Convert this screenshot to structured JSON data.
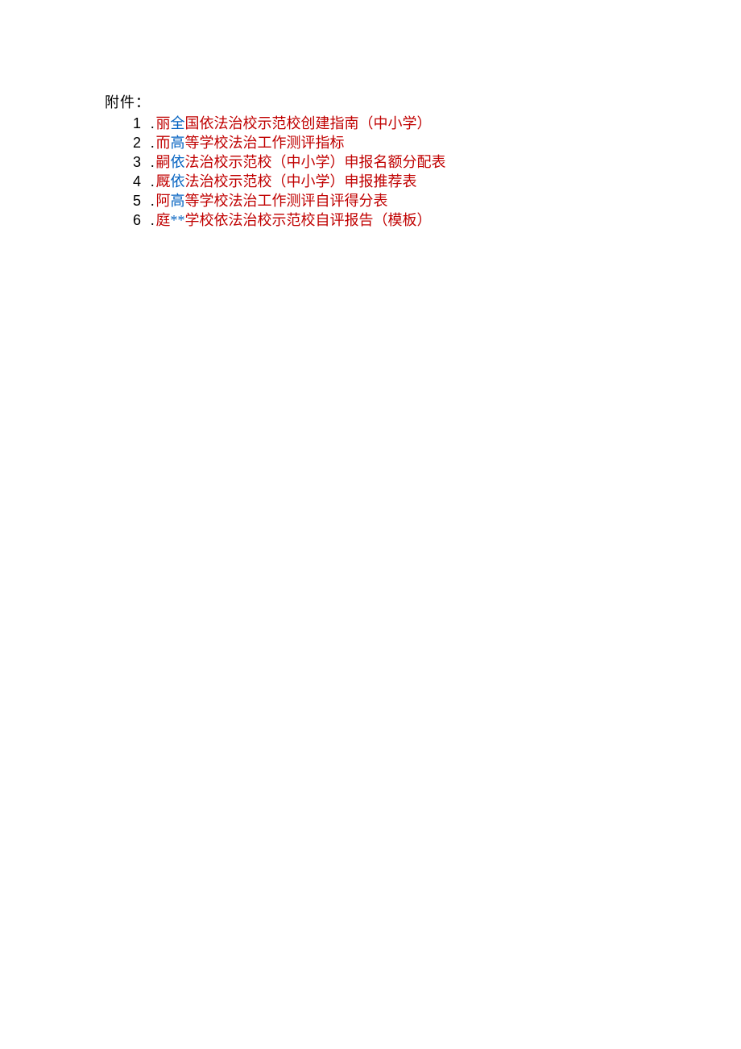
{
  "header": "附件：",
  "items": [
    {
      "num": "1",
      "prefix": "丽",
      "link": "全",
      "rest": "国依法治校示范校创建指南（中小学）"
    },
    {
      "num": "2",
      "prefix": "而",
      "link": "高",
      "rest": "等学校法治工作测评指标"
    },
    {
      "num": "3",
      "prefix": "嗣",
      "link": "依",
      "rest": "法治校示范校（中小学）申报名额分配表"
    },
    {
      "num": "4",
      "prefix": "厩",
      "link": "依",
      "rest": "法治校示范校（中小学）申报推荐表"
    },
    {
      "num": "5",
      "prefix": "阿",
      "link": "高",
      "rest": "等学校法治工作测评自评得分表"
    },
    {
      "num": "6",
      "prefix": "庭",
      "link": "**",
      "rest": "学校依法治校示范校自评报告（模板）"
    }
  ]
}
